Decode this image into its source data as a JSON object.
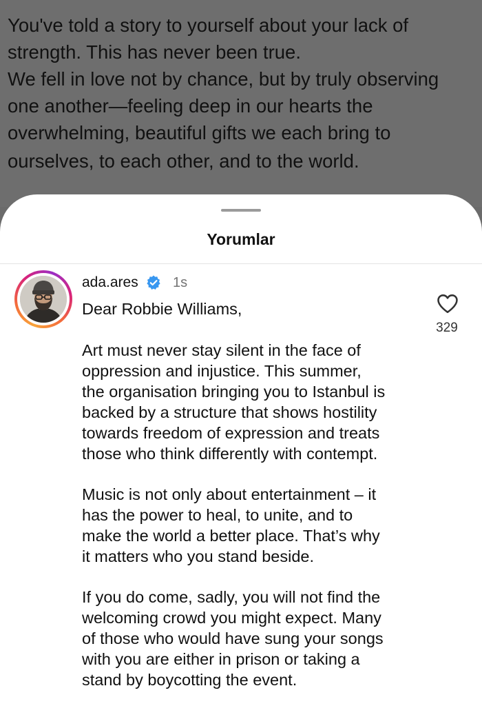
{
  "caption": {
    "lines": [
      "You've told a story to yourself about your lack of",
      "strength. This has never been true.",
      "We fell in love not by chance, but by truly observing",
      "one another—feeling deep in our hearts the",
      "overwhelming, beautiful gifts we each bring to",
      "ourselves, to each other, and to the world."
    ]
  },
  "sheet": {
    "title": "Yorumlar"
  },
  "comment": {
    "username": "ada.ares",
    "verified_icon": "verified-badge-icon",
    "timestamp": "1s",
    "like_icon": "heart-outline-icon",
    "like_count": "329",
    "lines": [
      "Dear Robbie Williams,",
      "Art must never stay silent in the face of",
      "oppression and injustice. This summer,",
      "the organisation bringing you to Istanbul is",
      "backed by a structure that shows hostility",
      "towards freedom of expression and treats",
      "those who think differently with contempt.",
      "Music is not only about entertainment – it",
      "has the power to heal, to unite, and to",
      "make the world a better place. That’s why",
      "it matters who you stand beside.",
      "If you do come, sadly, you will not find the",
      "welcoming crowd you might expect. Many",
      "of those who would have sung your songs",
      "with you are either in prison or taking a",
      "stand by boycotting the event."
    ]
  },
  "colors": {
    "overlay": "#6e6e6e",
    "sheet_bg": "#ffffff",
    "verified_blue": "#3897f0",
    "meta_gray": "#737373"
  }
}
